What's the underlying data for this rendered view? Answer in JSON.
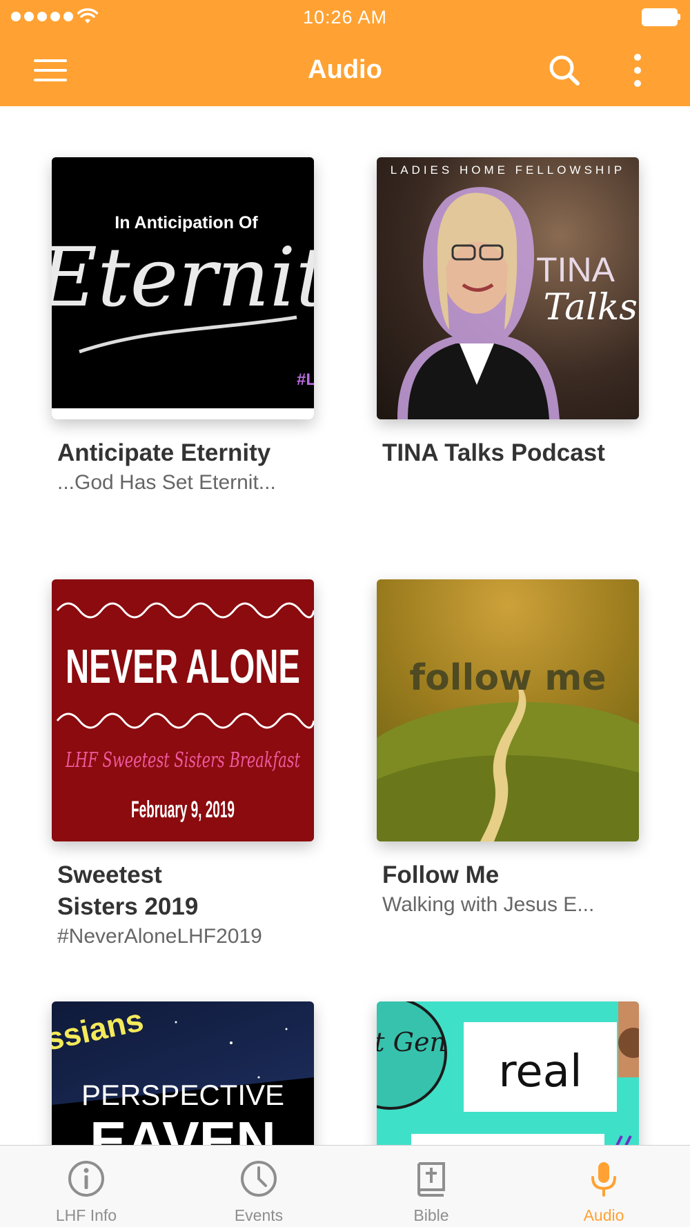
{
  "status_bar": {
    "time": "10:26 AM"
  },
  "nav": {
    "title": "Audio"
  },
  "cards": [
    {
      "title": "Anticipate Eternity",
      "subtitle": "...God Has Set Eternit...",
      "art": {
        "line1": "In Anticipation Of",
        "line2": "Eternit",
        "tag": "#L"
      }
    },
    {
      "title": "TINA Talks Podcast",
      "subtitle": "",
      "art": {
        "header": "LADIES HOME FELLOWSHIP",
        "line1": "TINA",
        "line2": "Talks"
      }
    },
    {
      "title": "Sweetest Sisters 2019",
      "subtitle": "#NeverAloneLHF2019",
      "art": {
        "line1": "NEVER ALONE",
        "line2": "LHF Sweetest Sisters Breakfast",
        "line3": "February 9, 2019"
      }
    },
    {
      "title": "Follow Me",
      "subtitle": "Walking with Jesus E...",
      "art": {
        "line1": "follow me"
      }
    },
    {
      "title": "",
      "subtitle": "",
      "art": {
        "line1": "ssians",
        "line2": "PERSPECTIVE",
        "line3": "EAVEN"
      }
    },
    {
      "title": "",
      "subtitle": "",
      "art": {
        "badge": "Next Gen",
        "line1": "real"
      }
    }
  ],
  "tabs": [
    {
      "label": "LHF Info",
      "icon": "info-icon"
    },
    {
      "label": "Events",
      "icon": "clock-icon"
    },
    {
      "label": "Bible",
      "icon": "bible-icon"
    },
    {
      "label": "Audio",
      "icon": "microphone-icon",
      "active": true
    }
  ],
  "colors": {
    "accent": "#ffa233",
    "inactive": "#8e8e8e"
  }
}
